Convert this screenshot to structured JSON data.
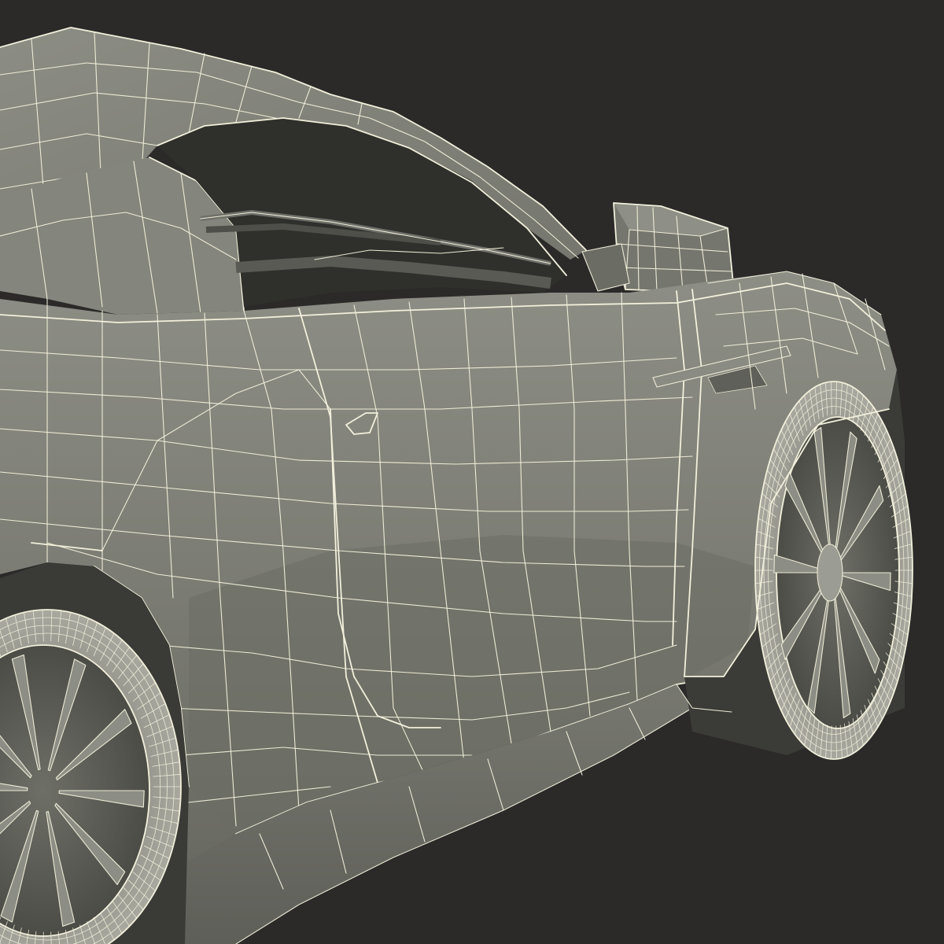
{
  "scene": {
    "subject": "",
    "colors": {
      "background": "#2b2a29",
      "body_shade": "#7c7c72",
      "body_light": "#8a8b81",
      "body_dark": "#55564f",
      "wire": "#f2f0dc",
      "cabin_dark": "#2f302b",
      "tire": "#9c9b92"
    }
  }
}
